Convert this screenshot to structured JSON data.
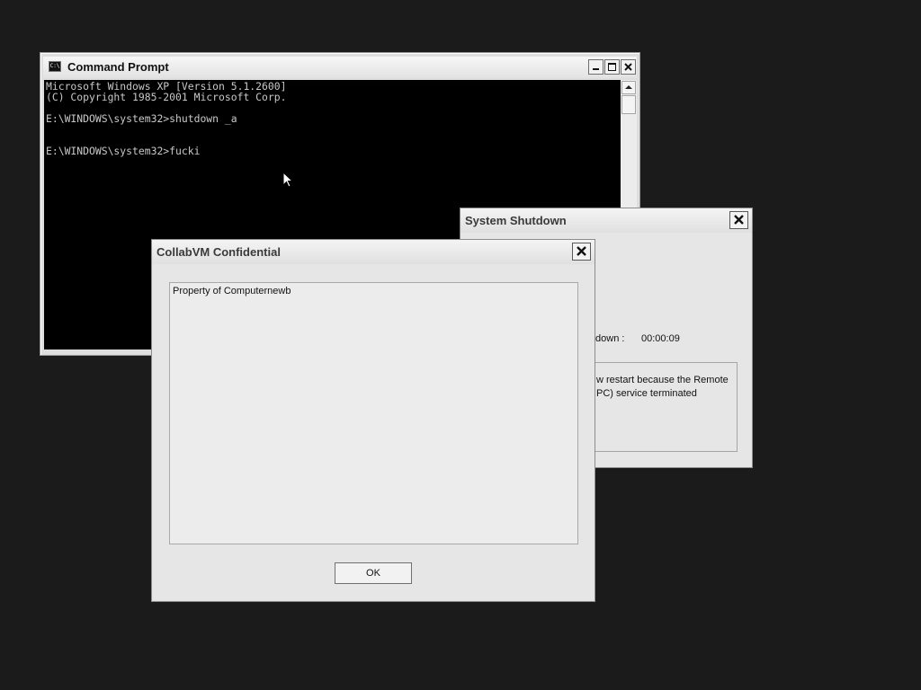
{
  "command_prompt": {
    "title": "Command Prompt",
    "icon": "console-icon",
    "icon_glyph": "C:\\",
    "lines": [
      "Microsoft Windows XP [Version 5.1.2600]",
      "(C) Copyright 1985-2001 Microsoft Corp.",
      "",
      "E:\\WINDOWS\\system32>shutdown _a",
      "",
      "",
      "E:\\WINDOWS\\system32>fucki"
    ]
  },
  "system_shutdown": {
    "title": "System Shutdown",
    "countdown_label": "tdown :",
    "countdown_value": "00:00:09",
    "message_line1": "w restart because the Remote",
    "message_line2": "PC) service terminated"
  },
  "collab_dialog": {
    "title": "CollabVM Confidential",
    "text": "Property of Computernewb",
    "ok_label": "OK"
  }
}
